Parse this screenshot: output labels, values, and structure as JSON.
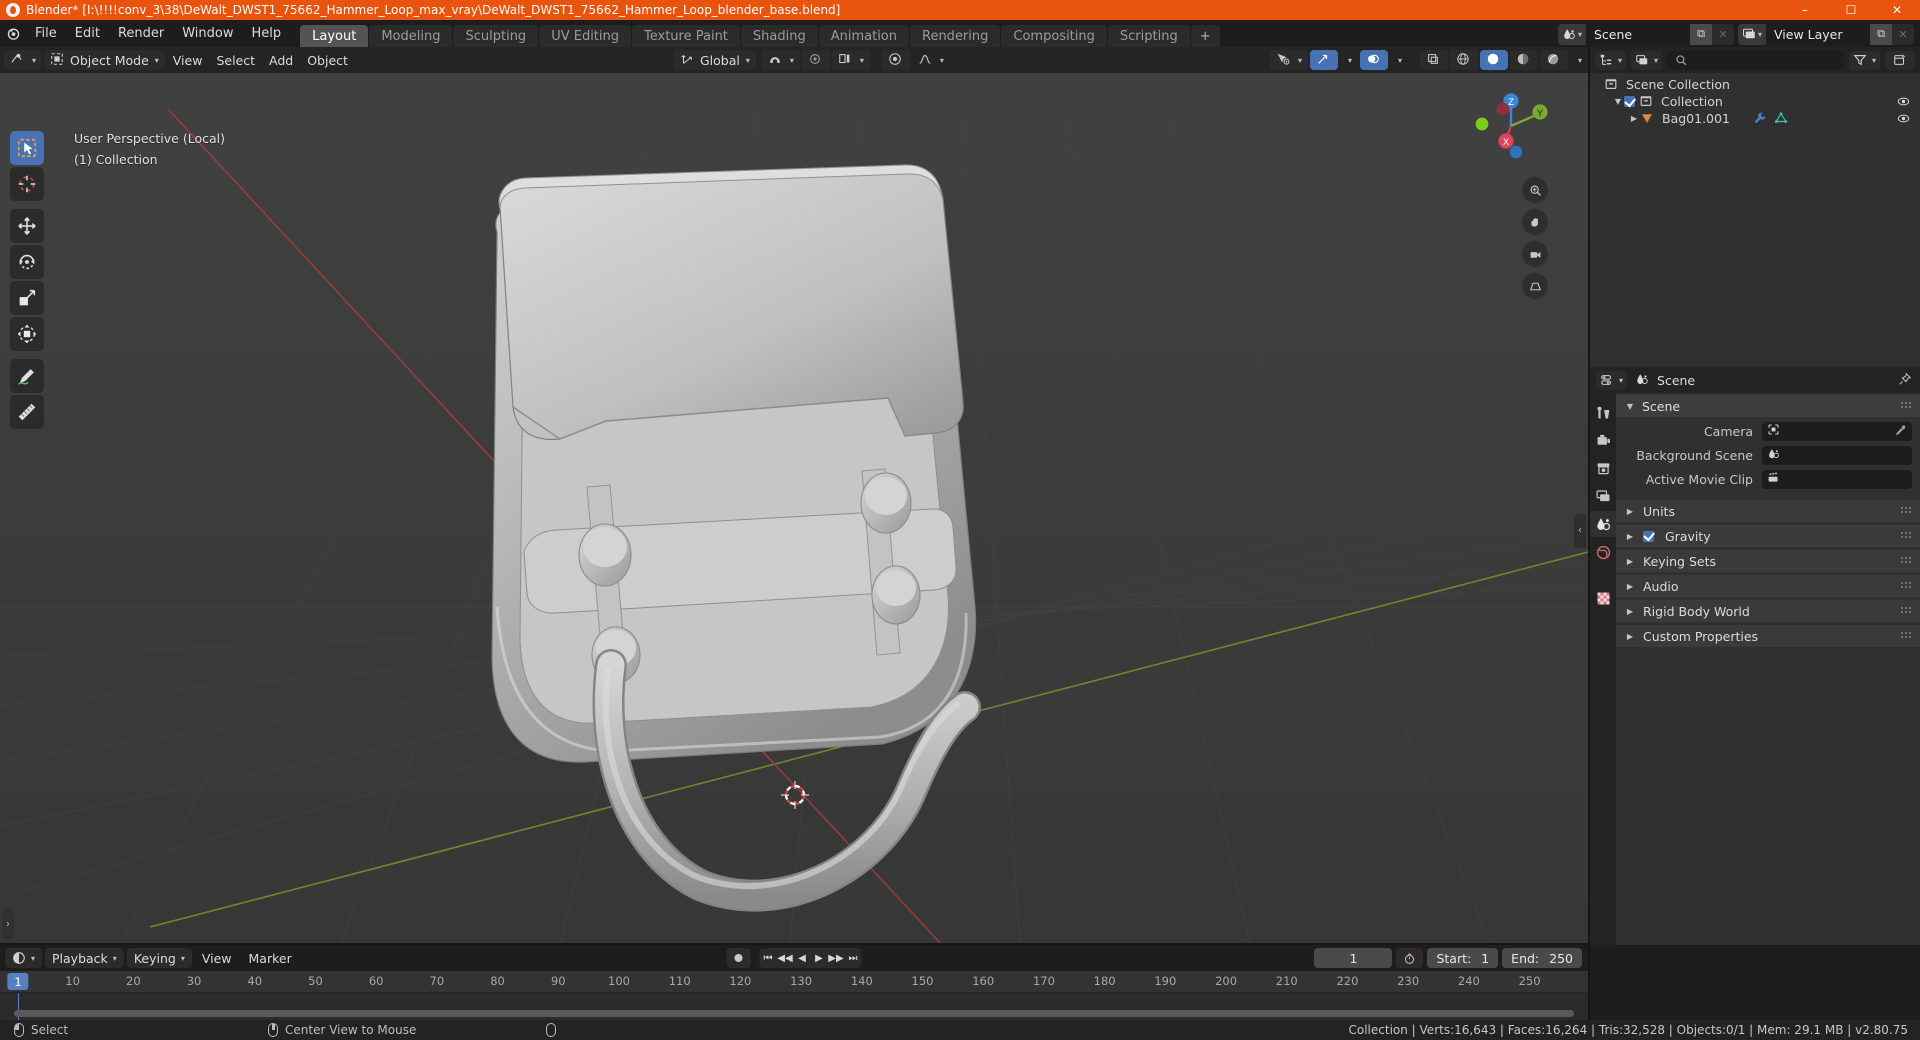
{
  "window": {
    "title": "Blender* [I:\\!!!!conv_3\\38\\DeWalt_DWST1_75662_Hammer_Loop_max_vray\\DeWalt_DWST1_75662_Hammer_Loop_blender_base.blend]",
    "minimize": "–",
    "maximize": "☐",
    "close": "✕",
    "accent_color": "#e8530d"
  },
  "topbar": {
    "menus": [
      "File",
      "Edit",
      "Render",
      "Window",
      "Help"
    ],
    "workspaces": [
      {
        "label": "Layout",
        "active": true
      },
      {
        "label": "Modeling",
        "active": false
      },
      {
        "label": "Sculpting",
        "active": false
      },
      {
        "label": "UV Editing",
        "active": false
      },
      {
        "label": "Texture Paint",
        "active": false
      },
      {
        "label": "Shading",
        "active": false
      },
      {
        "label": "Animation",
        "active": false
      },
      {
        "label": "Rendering",
        "active": false
      },
      {
        "label": "Compositing",
        "active": false
      },
      {
        "label": "Scripting",
        "active": false
      }
    ],
    "add_workspace": "+",
    "scene_name": "Scene",
    "view_layer_name": "View Layer",
    "new_copy_label": "⧉",
    "unlink_label": "✕"
  },
  "viewport": {
    "mode": "Object Mode",
    "menus": [
      "View",
      "Select",
      "Add",
      "Object"
    ],
    "transform_orientation": "Global",
    "overlay_text_line1": "User Perspective (Local)",
    "overlay_text_line2": "(1) Collection",
    "gizmo_axes": [
      "X",
      "Y",
      "Z"
    ],
    "tools": [
      {
        "name": "tweak-select-tool",
        "active": true
      },
      {
        "name": "cursor-tool",
        "active": false
      },
      {
        "name": "move-tool",
        "active": false
      },
      {
        "name": "rotate-tool",
        "active": false
      },
      {
        "name": "scale-tool",
        "active": false
      },
      {
        "name": "transform-tool",
        "active": false
      },
      {
        "name": "annotate-tool",
        "active": false
      },
      {
        "name": "measure-tool",
        "active": false
      }
    ],
    "shading_modes": [
      "wireframe",
      "solid",
      "material-preview",
      "rendered"
    ],
    "active_shading": "solid"
  },
  "outliner": {
    "search_placeholder": "",
    "rows": [
      {
        "label": "Scene Collection",
        "indent": 0,
        "icon": "collection-icon",
        "has_triangle": false,
        "has_checkbox": false,
        "has_eye": false
      },
      {
        "label": "Collection",
        "indent": 1,
        "icon": "collection-icon",
        "has_triangle": true,
        "has_checkbox": true,
        "has_eye": true
      },
      {
        "label": "Bag01.001",
        "indent": 2,
        "icon": "mesh-object-icon",
        "has_triangle": true,
        "has_checkbox": false,
        "has_eye": true
      }
    ]
  },
  "properties": {
    "breadcrumb": "Scene",
    "tabs": [
      {
        "name": "tool-tab",
        "active": false
      },
      {
        "name": "render-tab",
        "active": false
      },
      {
        "name": "output-tab",
        "active": false
      },
      {
        "name": "view-layer-tab",
        "active": false
      },
      {
        "name": "scene-tab",
        "active": true
      },
      {
        "name": "world-tab",
        "active": false
      },
      {
        "name": "texture-tab",
        "active": false
      }
    ],
    "panel_title": "Scene",
    "fields": [
      {
        "label": "Camera",
        "value": "",
        "icon": "camera-icon",
        "eyedropper": true
      },
      {
        "label": "Background Scene",
        "value": "",
        "icon": "scene-icon",
        "eyedropper": false
      },
      {
        "label": "Active Movie Clip",
        "value": "",
        "icon": "clip-icon",
        "eyedropper": false
      }
    ],
    "sections": [
      {
        "label": "Units",
        "checkbox": false
      },
      {
        "label": "Gravity",
        "checkbox": true
      },
      {
        "label": "Keying Sets",
        "checkbox": false
      },
      {
        "label": "Audio",
        "checkbox": false
      },
      {
        "label": "Rigid Body World",
        "checkbox": false
      },
      {
        "label": "Custom Properties",
        "checkbox": false
      }
    ]
  },
  "timeline": {
    "menus": [
      "Playback",
      "Keying",
      "View",
      "Marker"
    ],
    "current_frame": "1",
    "start_label": "Start:",
    "start_value": "1",
    "end_label": "End:",
    "end_value": "250",
    "ticks": [
      10,
      20,
      30,
      40,
      50,
      60,
      70,
      80,
      90,
      100,
      110,
      120,
      130,
      140,
      150,
      160,
      170,
      180,
      190,
      200,
      210,
      220,
      230,
      240,
      250
    ],
    "playhead_frame": "1"
  },
  "statusbar": {
    "left_items": [
      {
        "icon": "mouse-left-icon",
        "label": "Select"
      },
      {
        "icon": "mouse-middle-icon",
        "label": "Center View to Mouse"
      },
      {
        "icon": "mouse-right-icon",
        "label": ""
      }
    ],
    "stats": "Collection | Verts:16,643 | Faces:16,264 | Tris:32,528 | Objects:0/1 | Mem: 29.1 MB | v2.80.75"
  }
}
